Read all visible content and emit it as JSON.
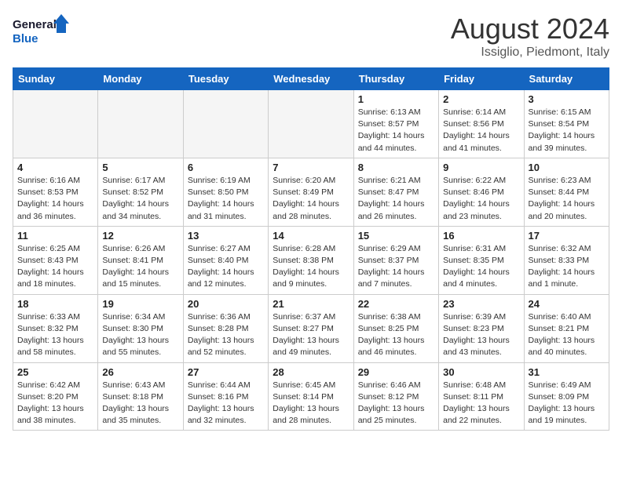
{
  "logo": {
    "line1": "General",
    "line2": "Blue"
  },
  "title": "August 2024",
  "location": "Issiglio, Piedmont, Italy",
  "weekdays": [
    "Sunday",
    "Monday",
    "Tuesday",
    "Wednesday",
    "Thursday",
    "Friday",
    "Saturday"
  ],
  "weeks": [
    [
      {
        "day": "",
        "info": ""
      },
      {
        "day": "",
        "info": ""
      },
      {
        "day": "",
        "info": ""
      },
      {
        "day": "",
        "info": ""
      },
      {
        "day": "1",
        "info": "Sunrise: 6:13 AM\nSunset: 8:57 PM\nDaylight: 14 hours\nand 44 minutes."
      },
      {
        "day": "2",
        "info": "Sunrise: 6:14 AM\nSunset: 8:56 PM\nDaylight: 14 hours\nand 41 minutes."
      },
      {
        "day": "3",
        "info": "Sunrise: 6:15 AM\nSunset: 8:54 PM\nDaylight: 14 hours\nand 39 minutes."
      }
    ],
    [
      {
        "day": "4",
        "info": "Sunrise: 6:16 AM\nSunset: 8:53 PM\nDaylight: 14 hours\nand 36 minutes."
      },
      {
        "day": "5",
        "info": "Sunrise: 6:17 AM\nSunset: 8:52 PM\nDaylight: 14 hours\nand 34 minutes."
      },
      {
        "day": "6",
        "info": "Sunrise: 6:19 AM\nSunset: 8:50 PM\nDaylight: 14 hours\nand 31 minutes."
      },
      {
        "day": "7",
        "info": "Sunrise: 6:20 AM\nSunset: 8:49 PM\nDaylight: 14 hours\nand 28 minutes."
      },
      {
        "day": "8",
        "info": "Sunrise: 6:21 AM\nSunset: 8:47 PM\nDaylight: 14 hours\nand 26 minutes."
      },
      {
        "day": "9",
        "info": "Sunrise: 6:22 AM\nSunset: 8:46 PM\nDaylight: 14 hours\nand 23 minutes."
      },
      {
        "day": "10",
        "info": "Sunrise: 6:23 AM\nSunset: 8:44 PM\nDaylight: 14 hours\nand 20 minutes."
      }
    ],
    [
      {
        "day": "11",
        "info": "Sunrise: 6:25 AM\nSunset: 8:43 PM\nDaylight: 14 hours\nand 18 minutes."
      },
      {
        "day": "12",
        "info": "Sunrise: 6:26 AM\nSunset: 8:41 PM\nDaylight: 14 hours\nand 15 minutes."
      },
      {
        "day": "13",
        "info": "Sunrise: 6:27 AM\nSunset: 8:40 PM\nDaylight: 14 hours\nand 12 minutes."
      },
      {
        "day": "14",
        "info": "Sunrise: 6:28 AM\nSunset: 8:38 PM\nDaylight: 14 hours\nand 9 minutes."
      },
      {
        "day": "15",
        "info": "Sunrise: 6:29 AM\nSunset: 8:37 PM\nDaylight: 14 hours\nand 7 minutes."
      },
      {
        "day": "16",
        "info": "Sunrise: 6:31 AM\nSunset: 8:35 PM\nDaylight: 14 hours\nand 4 minutes."
      },
      {
        "day": "17",
        "info": "Sunrise: 6:32 AM\nSunset: 8:33 PM\nDaylight: 14 hours\nand 1 minute."
      }
    ],
    [
      {
        "day": "18",
        "info": "Sunrise: 6:33 AM\nSunset: 8:32 PM\nDaylight: 13 hours\nand 58 minutes."
      },
      {
        "day": "19",
        "info": "Sunrise: 6:34 AM\nSunset: 8:30 PM\nDaylight: 13 hours\nand 55 minutes."
      },
      {
        "day": "20",
        "info": "Sunrise: 6:36 AM\nSunset: 8:28 PM\nDaylight: 13 hours\nand 52 minutes."
      },
      {
        "day": "21",
        "info": "Sunrise: 6:37 AM\nSunset: 8:27 PM\nDaylight: 13 hours\nand 49 minutes."
      },
      {
        "day": "22",
        "info": "Sunrise: 6:38 AM\nSunset: 8:25 PM\nDaylight: 13 hours\nand 46 minutes."
      },
      {
        "day": "23",
        "info": "Sunrise: 6:39 AM\nSunset: 8:23 PM\nDaylight: 13 hours\nand 43 minutes."
      },
      {
        "day": "24",
        "info": "Sunrise: 6:40 AM\nSunset: 8:21 PM\nDaylight: 13 hours\nand 40 minutes."
      }
    ],
    [
      {
        "day": "25",
        "info": "Sunrise: 6:42 AM\nSunset: 8:20 PM\nDaylight: 13 hours\nand 38 minutes."
      },
      {
        "day": "26",
        "info": "Sunrise: 6:43 AM\nSunset: 8:18 PM\nDaylight: 13 hours\nand 35 minutes."
      },
      {
        "day": "27",
        "info": "Sunrise: 6:44 AM\nSunset: 8:16 PM\nDaylight: 13 hours\nand 32 minutes."
      },
      {
        "day": "28",
        "info": "Sunrise: 6:45 AM\nSunset: 8:14 PM\nDaylight: 13 hours\nand 28 minutes."
      },
      {
        "day": "29",
        "info": "Sunrise: 6:46 AM\nSunset: 8:12 PM\nDaylight: 13 hours\nand 25 minutes."
      },
      {
        "day": "30",
        "info": "Sunrise: 6:48 AM\nSunset: 8:11 PM\nDaylight: 13 hours\nand 22 minutes."
      },
      {
        "day": "31",
        "info": "Sunrise: 6:49 AM\nSunset: 8:09 PM\nDaylight: 13 hours\nand 19 minutes."
      }
    ]
  ]
}
